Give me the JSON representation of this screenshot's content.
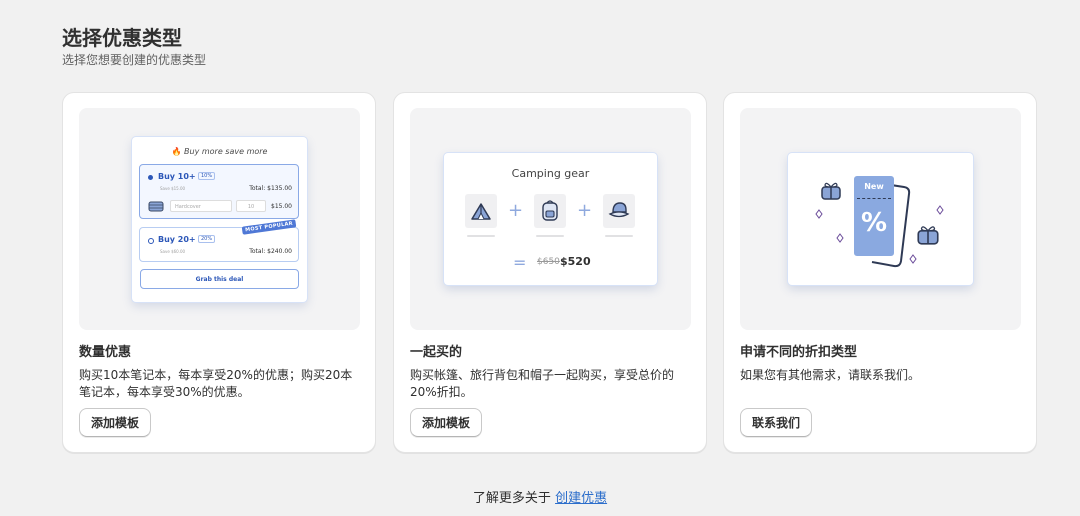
{
  "header": {
    "title": "选择优惠类型",
    "subtitle": "选择您想要创建的优惠类型"
  },
  "cards": [
    {
      "title": "数量优惠",
      "description": "购买10本笔记本，每本享受20%的优惠；购买20本笔记本，每本享受30%的优惠。",
      "button_label": "添加模板",
      "illustration": {
        "heading": "Buy more save more",
        "tiers": [
          {
            "label": "Buy 10+",
            "badge": "10%",
            "save": "Save $15.00",
            "total": "Total: $135.00",
            "variant": "Hardcover",
            "qty": "10",
            "price": "$15.00"
          },
          {
            "label": "Buy 20+",
            "badge": "20%",
            "save": "Save $60.00",
            "total": "Total: $240.00"
          }
        ],
        "popular_tag": "MOST POPULAR",
        "cta": "Grab this deal"
      }
    },
    {
      "title": "一起买的",
      "description": "购买帐篷、旅行背包和帽子一起购买，享受总价的20%折扣。",
      "button_label": "添加模板",
      "illustration": {
        "heading": "Camping gear",
        "old_price": "$650",
        "new_price": "$520",
        "items": [
          "tent-icon",
          "backpack-icon",
          "hat-icon"
        ]
      }
    },
    {
      "title": "申请不同的折扣类型",
      "description": "如果您有其他需求，请联系我们。",
      "button_label": "联系我们",
      "illustration": {
        "tag": "New",
        "symbol": "%"
      }
    }
  ],
  "footer": {
    "prefix": "了解更多关于",
    "link": "创建优惠"
  },
  "colors": {
    "background": "#f1f1f1",
    "card": "#ffffff",
    "accent_blue": "#2c57b8",
    "link": "#2c6ecb",
    "illustration_bg": "#f3f3f4"
  }
}
